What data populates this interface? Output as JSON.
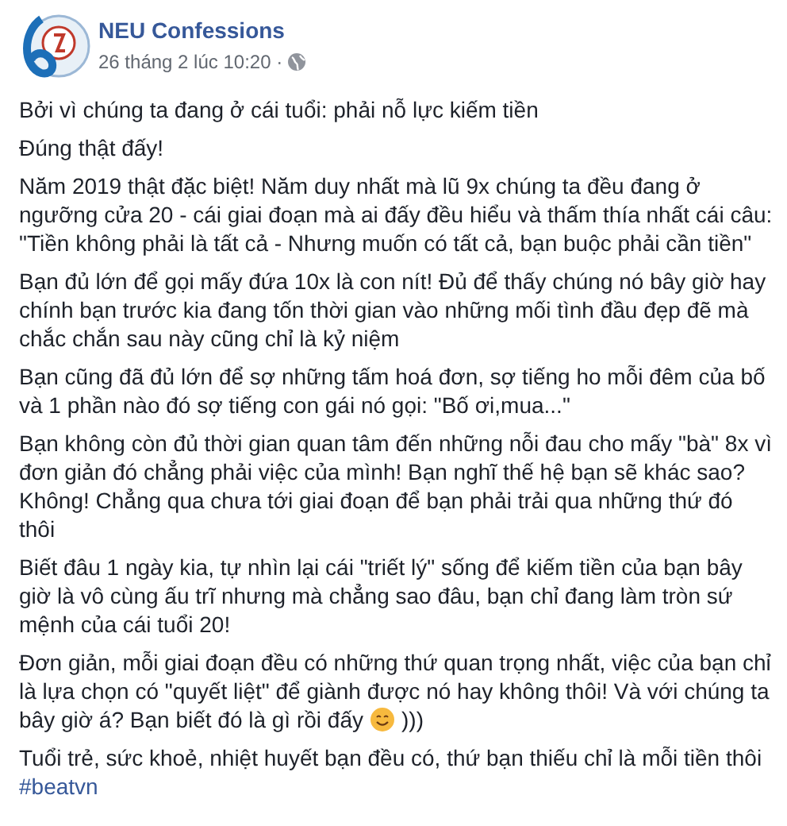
{
  "post": {
    "author": "NEU Confessions",
    "time": "26 tháng 2 lúc 10:20 ·",
    "paragraphs": [
      {
        "text": "Bởi vì chúng ta đang ở cái tuổi: phải nỗ lực kiếm tiền"
      },
      {
        "text": "Đúng thật đấy!"
      },
      {
        "text": "Năm 2019 thật đặc biệt! Năm duy nhất mà lũ 9x chúng ta đều đang ở ngưỡng cửa 20 - cái giai đoạn mà ai đấy đều hiểu và thấm thía nhất cái câu: \"Tiền không phải là tất cả - Nhưng muốn có tất cả, bạn buộc phải cần tiền\""
      },
      {
        "text": "Bạn đủ lớn để gọi mấy đứa 10x là con nít! Đủ để thấy chúng nó bây giờ hay chính bạn trước kia đang tốn thời gian vào những mối tình đầu đẹp đẽ mà chắc chắn sau này cũng chỉ là kỷ niệm"
      },
      {
        "text": "Bạn cũng đã đủ lớn để sợ những tấm hoá đơn, sợ tiếng ho mỗi đêm của bố và 1 phần nào đó sợ tiếng con gái nó gọi: \"Bố ơi,mua...\""
      },
      {
        "text": "Bạn không còn đủ thời gian quan tâm đến những nỗi đau cho mấy \"bà\" 8x vì đơn giản đó chẳng phải việc của mình! Bạn nghĩ thế hệ bạn sẽ khác sao? Không! Chẳng qua chưa tới giai đoạn để bạn phải trải qua những thứ đó thôi"
      },
      {
        "text": "Biết đâu 1 ngày kia, tự nhìn lại cái \"triết lý\" sống để kiếm tiền của bạn bây giờ là vô cùng ấu trĩ nhưng mà chẳng sao đâu, bạn chỉ đang làm tròn sứ mệnh của cái tuổi 20!"
      },
      {
        "text": "Đơn giản, mỗi giai đoạn đều có những thứ quan trọng nhất, việc của bạn chỉ là lựa chọn có \"quyết liệt\" để giành được nó hay không thôi! Và với chúng ta",
        "tail": "bây giờ á? Bạn biết đó là gì rồi đấy",
        "emoji": true,
        "after": ")))"
      },
      {
        "text": "Tuổi trẻ, sức khoẻ, nhiệt huyết bạn đều có, thứ bạn thiếu chỉ là mỗi tiền thôi",
        "hashtag": "#beatvn"
      }
    ]
  }
}
